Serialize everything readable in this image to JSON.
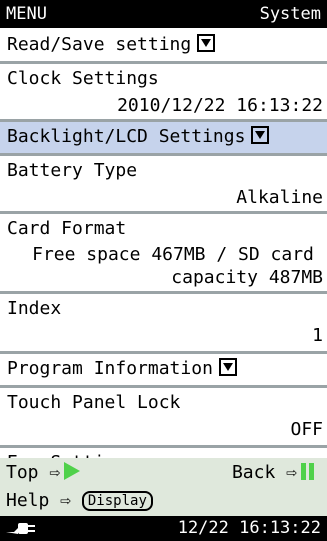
{
  "header": {
    "menu_label": "MENU",
    "section_label": "System"
  },
  "menu": {
    "read_save": {
      "label": "Read/Save setting"
    },
    "clock": {
      "label": "Clock Settings",
      "value": "2010/12/22 16:13:22"
    },
    "backlight": {
      "label": "Backlight/LCD Settings"
    },
    "battery": {
      "label": "Battery Type",
      "value": "Alkaline"
    },
    "card_format": {
      "label": "Card Format",
      "value_line1": "Free space 467MB / SD card",
      "value_line2": "capacity 487MB"
    },
    "index": {
      "label": "Index",
      "value": "1"
    },
    "program_info": {
      "label": "Program Information"
    },
    "touch_lock": {
      "label": "Touch Panel Lock",
      "value": "OFF"
    },
    "eco": {
      "label": "Eco Setting"
    }
  },
  "footer": {
    "top_label": "Top ⇨",
    "back_label": "Back ⇨",
    "help_label": "Help ⇨",
    "display_button": "Display"
  },
  "status": {
    "datetime": "12/22 16:13:22"
  },
  "colors": {
    "selected_row": "#c6d3ec",
    "footer_bg": "#dfe8dc",
    "accent_green": "#4fd14a",
    "divider": "#9aa3a6"
  }
}
